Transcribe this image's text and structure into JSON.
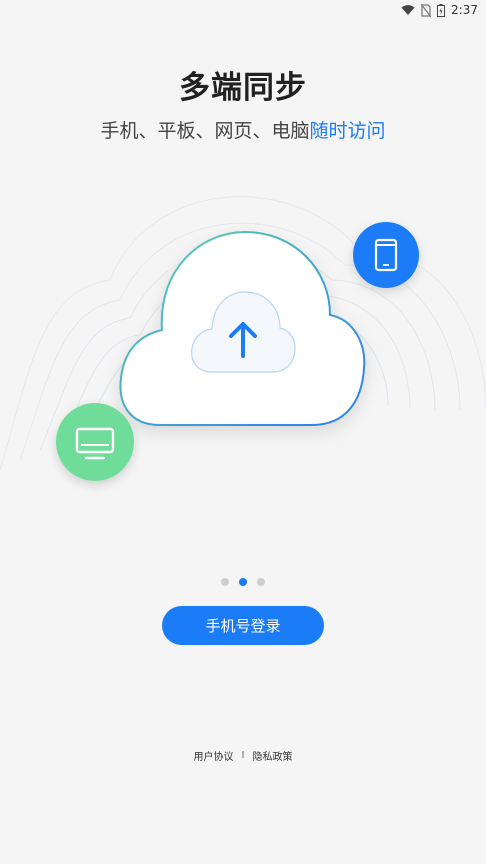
{
  "status_bar": {
    "time": "2:37",
    "icons": [
      "wifi-icon",
      "no-sim-icon",
      "battery-icon"
    ]
  },
  "onboarding": {
    "title": "多端同步",
    "subtitle_plain": "手机、平板、网页、电脑",
    "subtitle_accent": "随时访问",
    "page_indicator": {
      "total": 3,
      "current": 2
    }
  },
  "actions": {
    "login_label": "手机号登录"
  },
  "footer": {
    "user_agreement": "用户协议",
    "separator": "I",
    "privacy_policy": "隐私政策"
  },
  "colors": {
    "accent": "#1b7cf7",
    "device_green": "#6fdc9a",
    "background": "#f5f5f5"
  },
  "illustration": {
    "icons": [
      "cloud-upload-icon",
      "phone-icon",
      "monitor-icon"
    ]
  }
}
